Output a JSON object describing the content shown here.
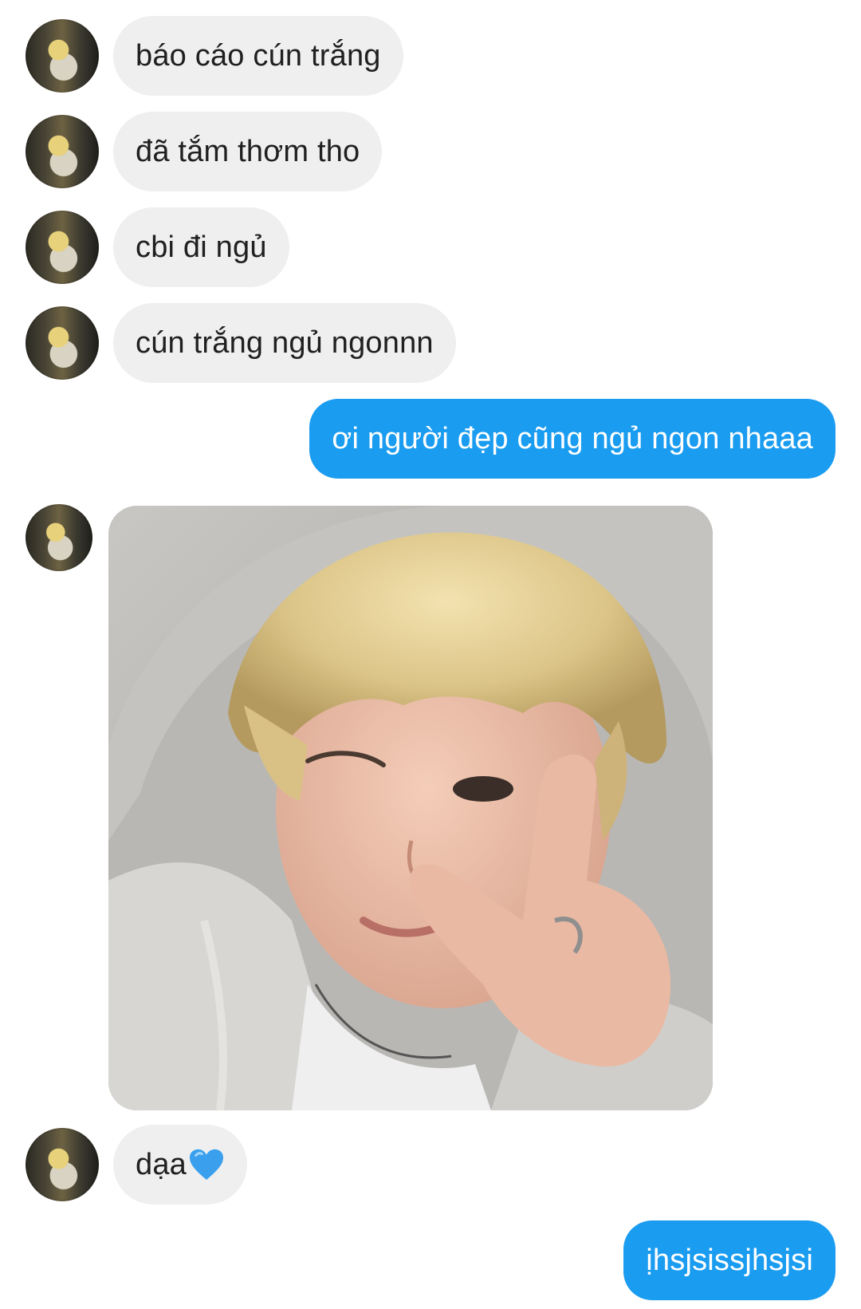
{
  "conversation": {
    "messages": [
      {
        "side": "in",
        "text": "báo cáo cún trắng"
      },
      {
        "side": "in",
        "text": "đã tắm thơm tho"
      },
      {
        "side": "in",
        "text": "cbi đi ngủ"
      },
      {
        "side": "in",
        "text": "cún trắng ngủ ngonnn"
      },
      {
        "side": "out",
        "text": "ơi người đẹp cũng ngủ ngon nhaaa"
      },
      {
        "side": "in",
        "type": "photo",
        "description": "selfie-photo"
      },
      {
        "side": "in",
        "text": "dạa",
        "emoji": "blue-heart"
      },
      {
        "side": "out",
        "text": "ịhsjsissjhsjsi"
      }
    ]
  },
  "colors": {
    "incoming_bubble": "#efefef",
    "outgoing_bubble": "#1a9cf0",
    "incoming_text": "#202020",
    "outgoing_text": "#ffffff",
    "heart": "#3aa0ee"
  }
}
